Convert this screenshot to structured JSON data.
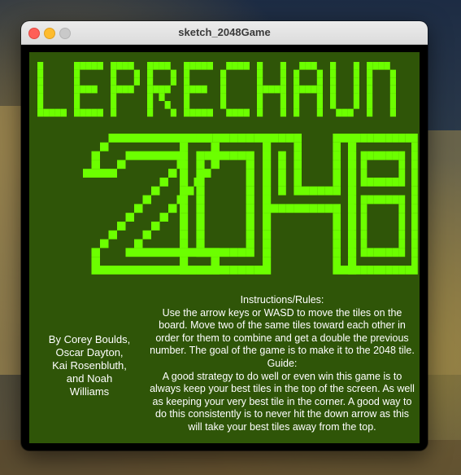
{
  "window": {
    "title": "sketch_2048Game"
  },
  "game": {
    "title_word": "LEPRECHAUN",
    "title_number": "2048",
    "accent_color": "#6cff00",
    "background_color": "#2f5508",
    "credits_lines": [
      "By Corey Boulds,",
      "Oscar Dayton,",
      "Kai Rosenbluth,",
      "and Noah",
      "Williams"
    ],
    "rules_lines": [
      "Instructions/Rules:",
      "Use the arrow keys or WASD to move the tiles on the",
      "board. Move two of the same tiles toward each other in",
      "order for them to combine and get a double the previous",
      "number. The goal of the game is to make it to the 2048 tile.",
      "Guide:",
      "A good strategy to do well or even win this game is to",
      "always keep your best tiles in the top of the screen. As well",
      "as keeping your very best tile in the corner. A good way to",
      "do this consistently is to never hit the down arrow as this",
      "will take your best tiles away from the top."
    ]
  },
  "icons": {
    "close": "close-icon",
    "minimize": "minimize-icon",
    "zoom": "zoom-icon"
  }
}
